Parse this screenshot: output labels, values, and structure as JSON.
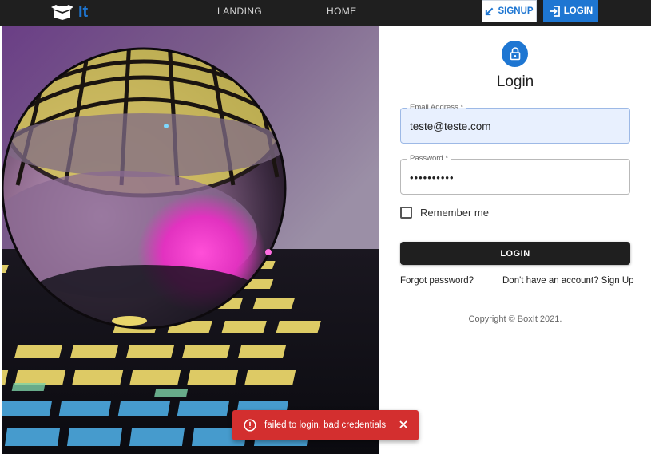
{
  "header": {
    "logo_text": "It",
    "nav": [
      {
        "label": "LANDING"
      },
      {
        "label": "HOME"
      }
    ],
    "signup_label": "SIGNUP",
    "login_label": "LOGIN",
    "accent_color": "#1e76d2",
    "bar_color": "#1f1f1f"
  },
  "login_form": {
    "title": "Login",
    "email": {
      "label": "Email Address *",
      "value": "teste@teste.com"
    },
    "password": {
      "label": "Password *",
      "value": "••••••••••"
    },
    "remember_label": "Remember me",
    "remember_checked": false,
    "submit_label": "LOGIN",
    "forgot_link": "Forgot password?",
    "signup_link": "Don't have an account? Sign Up",
    "copyright": "Copyright © BoxIt 2021."
  },
  "snackbar": {
    "message": "failed to login, bad credentials",
    "color": "#d32f2f",
    "icon": "error-outline-icon",
    "close_icon": "close-icon"
  }
}
